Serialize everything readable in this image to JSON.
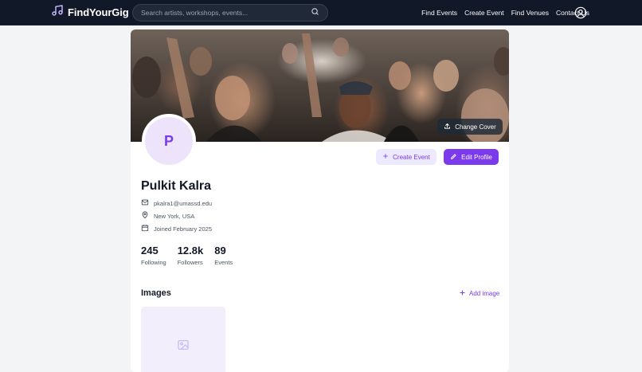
{
  "brand": {
    "name": "FindYourGig",
    "icon": "music-note-icon"
  },
  "search": {
    "placeholder": "Search artists, workshops, events...",
    "icon": "search-icon"
  },
  "nav": {
    "links": [
      "Find Events",
      "Create Event",
      "Find Venues",
      "Contact Us"
    ],
    "user_icon": "user-circle-icon"
  },
  "profile": {
    "change_cover_label": "Change Cover",
    "avatar_initial": "P",
    "create_event_label": "Create Event",
    "edit_profile_label": "Edit Profile",
    "name": "Pulkit Kalra",
    "email": "pkalra1@umassd.edu",
    "location": "New York, USA",
    "joined": "Joined February 2025",
    "stats": [
      {
        "value": "245",
        "label": "Following"
      },
      {
        "value": "12.8k",
        "label": "Followers"
      },
      {
        "value": "89",
        "label": "Events"
      }
    ]
  },
  "images_section": {
    "title": "Images",
    "add_label": "Add image",
    "placeholder_icon": "image-placeholder-icon"
  },
  "colors": {
    "accent": "#7c3aed",
    "accent_light": "#ede9fe",
    "navbar": "#111827"
  }
}
